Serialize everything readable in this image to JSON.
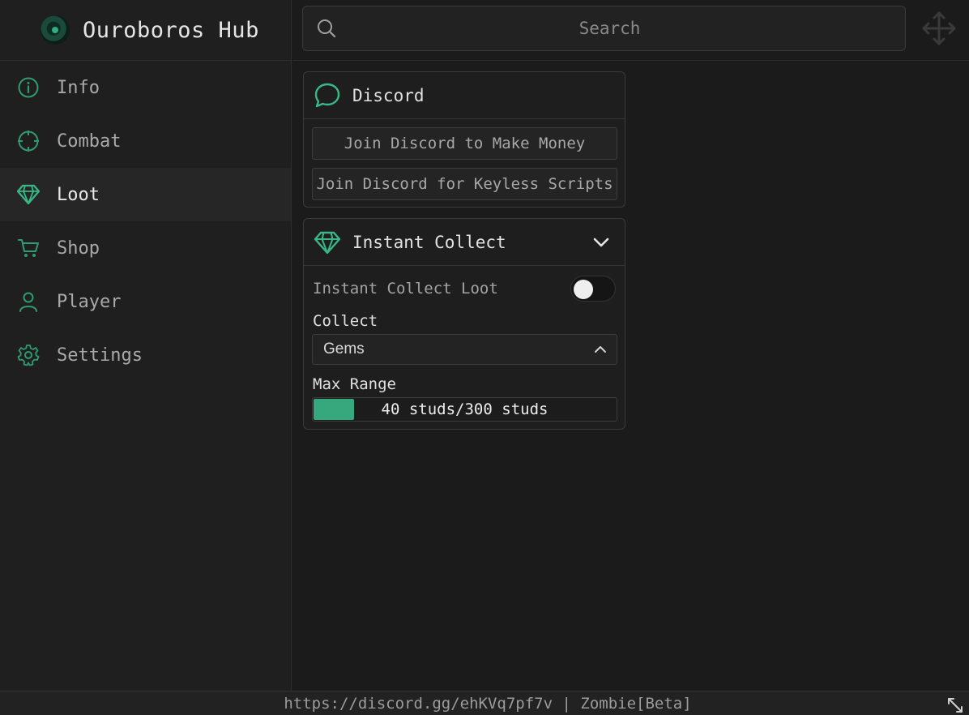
{
  "app": {
    "title": "Ouroboros Hub",
    "logo_icon": "ouroboros-logo-icon"
  },
  "colors": {
    "accent": "#37a77e",
    "background": "#1b1b1b",
    "panel": "#1e1e1e",
    "active_item": "#262626"
  },
  "sidebar": {
    "items": [
      {
        "label": "Info",
        "icon": "info-icon",
        "active": false
      },
      {
        "label": "Combat",
        "icon": "crosshair-icon",
        "active": false
      },
      {
        "label": "Loot",
        "icon": "gem-icon",
        "active": true
      },
      {
        "label": "Shop",
        "icon": "cart-icon",
        "active": false
      },
      {
        "label": "Player",
        "icon": "user-icon",
        "active": false
      },
      {
        "label": "Settings",
        "icon": "gear-icon",
        "active": false
      }
    ]
  },
  "search": {
    "placeholder": "Search",
    "value": ""
  },
  "discord_section": {
    "title": "Discord",
    "icon": "chat-bubble-icon",
    "buttons": [
      "Join Discord to Make Money",
      "Join Discord for Keyless Scripts"
    ]
  },
  "instant_collect_section": {
    "title": "Instant Collect",
    "icon": "gem-icon",
    "expanded": true,
    "toggle": {
      "label": "Instant Collect Loot",
      "enabled": false
    },
    "collect_dropdown": {
      "label": "Collect",
      "selected": "Gems"
    },
    "max_range_slider": {
      "label": "Max Range",
      "display": "40 studs/300 studs",
      "value": 40,
      "max": 300
    }
  },
  "footer": {
    "text": "https://discord.gg/ehKVq7pf7v | Zombie[Beta]"
  }
}
